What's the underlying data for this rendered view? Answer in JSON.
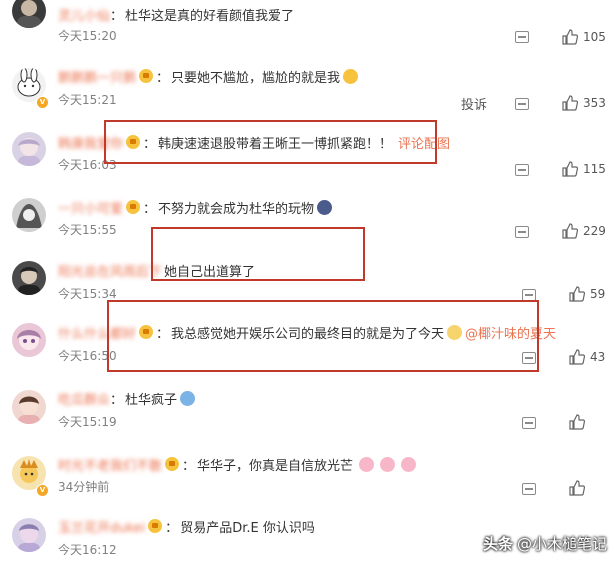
{
  "comments": [
    {
      "username": "灵儿小仙",
      "text": "杜华这是真的好看颜值我爱了",
      "time": "今天15:20",
      "likes": "105",
      "avatar_color": "#3a3a3a",
      "verified": false,
      "vip": false
    },
    {
      "username": "鹅鹅鹅一只鹅",
      "text": "只要她不尴尬，尴尬的就是我",
      "time": "今天15:21",
      "likes": "353",
      "avatar_color": "#f2f2f2",
      "verified": true,
      "vip": true,
      "report_label": "投诉",
      "emoji_color": "#f7c33f"
    },
    {
      "username": "韩庚我爱你",
      "text": "韩庚速速退股带着王晰王一博抓紧跑！！",
      "link": "评论配图",
      "time": "今天16:03",
      "likes": "115",
      "avatar_color": "#d9d2e4",
      "verified": false,
      "vip": true
    },
    {
      "username": "一只小可爱",
      "text": "不努力就会成为杜华的玩物",
      "time": "今天15:55",
      "likes": "229",
      "avatar_color": "#cfcfcf",
      "verified": false,
      "vip": true,
      "emoji_color": "#4a5b8c"
    },
    {
      "username": "阳光总在风雨后下",
      "text": "她自己出道算了",
      "time": "今天15:34",
      "likes": "59",
      "avatar_color": "#4a4a4a",
      "verified": false,
      "vip": false
    },
    {
      "username": "什么什么都好",
      "text": "我总感觉她开娱乐公司的最终目的就是为了今天",
      "mention": "@椰汁味的夏天",
      "time": "今天16:50",
      "likes": "43",
      "avatar_color": "#e9c7d6",
      "verified": false,
      "vip": true,
      "emoji_color": "#f7d36b"
    },
    {
      "username": "吃瓜群众",
      "text": "杜华疯子",
      "time": "今天15:19",
      "likes": "",
      "avatar_color": "#f0d8d0",
      "verified": false,
      "vip": false,
      "emoji_color": "#7bb3e6"
    },
    {
      "username": "时光不老我们不散",
      "text": "华华子，你真是自信放光芒",
      "time": "34分钟前",
      "likes": "",
      "avatar_color": "#f7e3b0",
      "verified": true,
      "vip": true,
      "emoji_color": "#f8b7c9"
    },
    {
      "username": "玉兰花开dukei",
      "text": "贸易产品Dr.E 你认识吗",
      "time": "今天16:12",
      "likes": "",
      "avatar_color": "#d7d0e6",
      "verified": false,
      "vip": true
    }
  ],
  "watermark": {
    "prefix": "头条",
    "handle": "@小木槌笔记"
  },
  "colors": {
    "accent": "#eb7350",
    "highlight_box": "#c0392b"
  }
}
